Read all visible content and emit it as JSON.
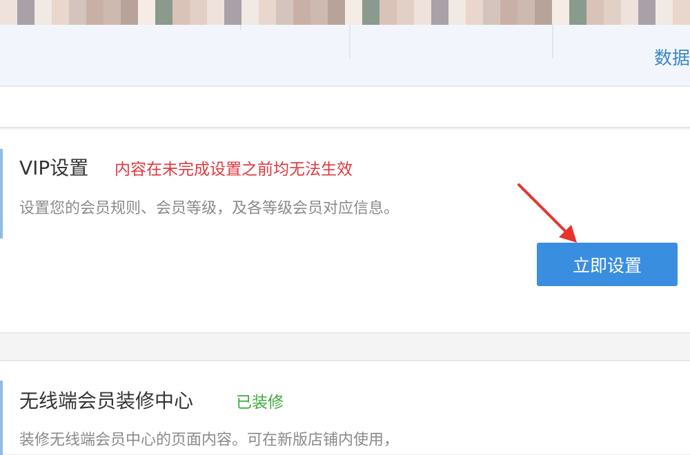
{
  "header": {
    "data_link_label": "数据"
  },
  "vip_card": {
    "title": "VIP设置",
    "status": "内容在未完成设置之前均无法生效",
    "status_color": "#e0383e",
    "description": "设置您的会员规则、会员等级，及各等级会员对应信息。",
    "button_label": "立即设置"
  },
  "decor_card": {
    "title": "无线端会员装修中心",
    "status": "已装修",
    "status_color": "#3cab3c",
    "description": "装修无线端会员中心的页面内容。可在新版店铺内使用，"
  },
  "annotation": {
    "arrow_color": "#e8332c"
  }
}
